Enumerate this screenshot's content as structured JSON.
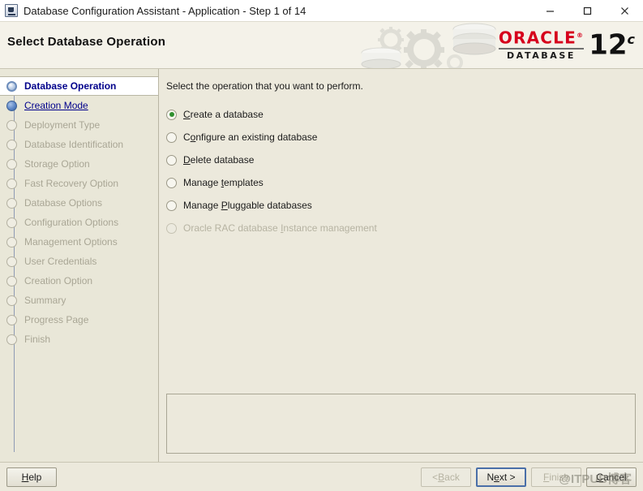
{
  "window": {
    "title": "Database Configuration Assistant - Application - Step 1 of 14",
    "icon": "java-cup-icon",
    "controls": {
      "minimize": "minimize-icon",
      "maximize": "maximize-icon",
      "close": "close-icon"
    }
  },
  "banner": {
    "title": "Select Database Operation",
    "brand_name": "ORACLE",
    "brand_trademark": "®",
    "brand_product": "DATABASE",
    "brand_version": "12",
    "brand_version_suffix": "c",
    "brand_color": "#d6001c"
  },
  "sidebar": {
    "items": [
      {
        "label": "Database Operation",
        "state": "current"
      },
      {
        "label": "Creation Mode",
        "state": "done"
      },
      {
        "label": "Deployment Type",
        "state": "todo"
      },
      {
        "label": "Database Identification",
        "state": "todo"
      },
      {
        "label": "Storage Option",
        "state": "todo"
      },
      {
        "label": "Fast Recovery Option",
        "state": "todo"
      },
      {
        "label": "Database Options",
        "state": "todo"
      },
      {
        "label": "Configuration Options",
        "state": "todo"
      },
      {
        "label": "Management Options",
        "state": "todo"
      },
      {
        "label": "User Credentials",
        "state": "todo"
      },
      {
        "label": "Creation Option",
        "state": "todo"
      },
      {
        "label": "Summary",
        "state": "todo"
      },
      {
        "label": "Progress Page",
        "state": "todo"
      },
      {
        "label": "Finish",
        "state": "todo"
      }
    ]
  },
  "main": {
    "prompt": "Select the operation that you want to perform.",
    "options": [
      {
        "label_pre": "",
        "mnemonic": "C",
        "label_post": "reate a database",
        "selected": true,
        "disabled": false
      },
      {
        "label_pre": "C",
        "mnemonic": "o",
        "label_post": "nfigure an existing database",
        "selected": false,
        "disabled": false
      },
      {
        "label_pre": "",
        "mnemonic": "D",
        "label_post": "elete database",
        "selected": false,
        "disabled": false
      },
      {
        "label_pre": "Manage ",
        "mnemonic": "t",
        "label_post": "emplates",
        "selected": false,
        "disabled": false
      },
      {
        "label_pre": "Manage ",
        "mnemonic": "P",
        "label_post": "luggable databases",
        "selected": false,
        "disabled": false
      },
      {
        "label_pre": "Oracle RAC database ",
        "mnemonic": "I",
        "label_post": "nstance management",
        "selected": false,
        "disabled": true
      }
    ],
    "message_panel_text": ""
  },
  "buttons": {
    "help": {
      "label_pre": "",
      "mnemonic": "H",
      "label_post": "elp",
      "disabled": false,
      "focused": false
    },
    "back": {
      "label_pre": "< ",
      "mnemonic": "B",
      "label_post": "ack",
      "disabled": true,
      "focused": false
    },
    "next": {
      "label_pre": "N",
      "mnemonic": "e",
      "label_post": "xt >",
      "disabled": false,
      "focused": true
    },
    "finish": {
      "label_pre": "",
      "mnemonic": "F",
      "label_post": "inish",
      "disabled": true,
      "focused": false
    },
    "cancel": {
      "label_pre": "",
      "mnemonic": "C",
      "label_post": "ancel",
      "disabled": false,
      "focused": false
    }
  },
  "watermark": {
    "text": "@ITPUB博客"
  }
}
